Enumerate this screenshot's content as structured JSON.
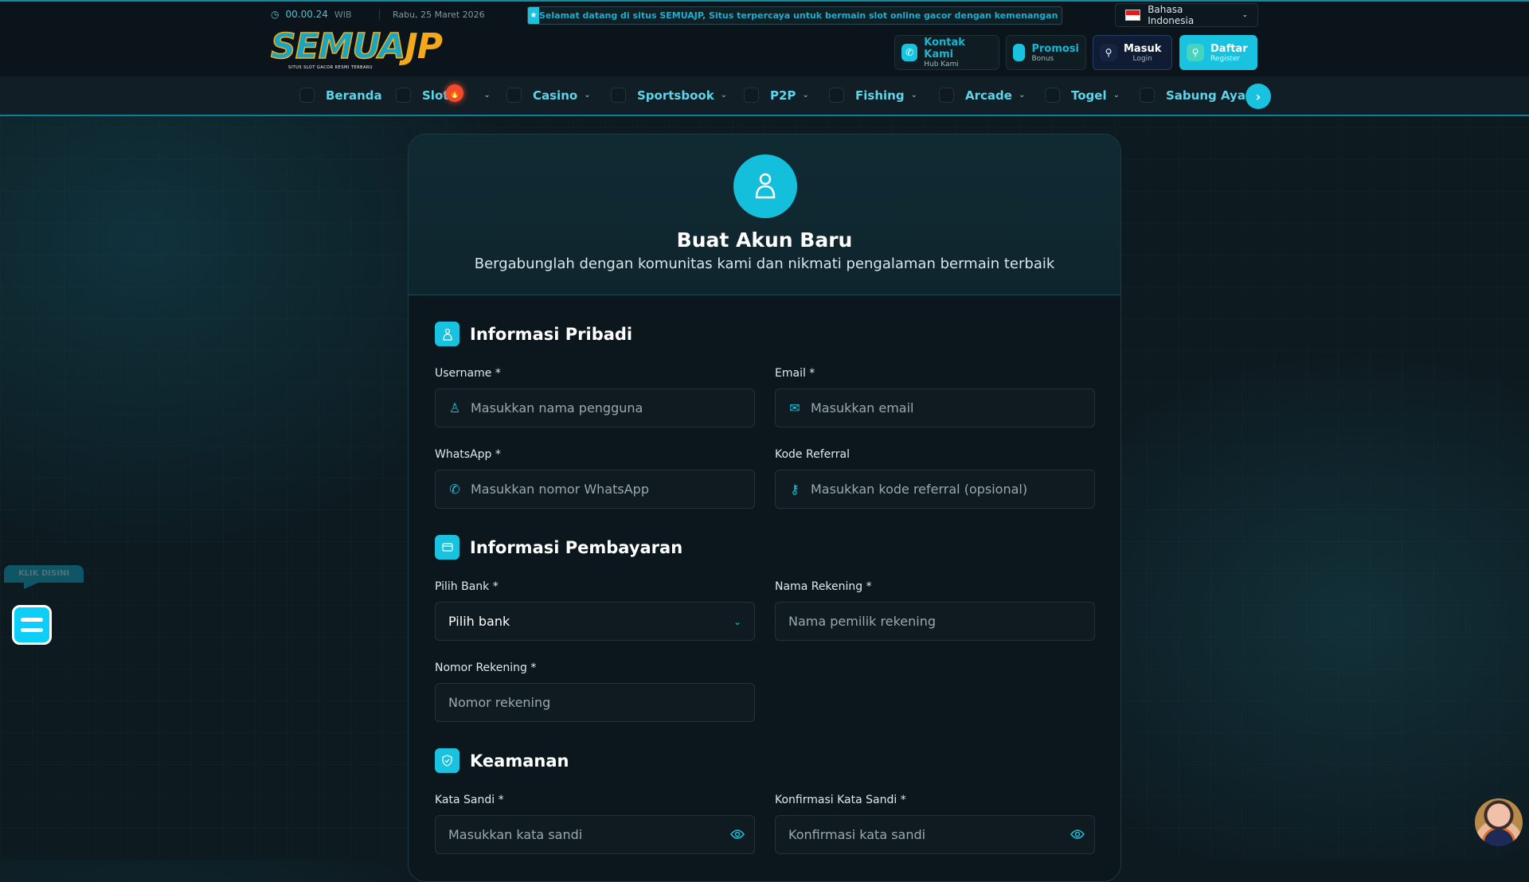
{
  "topbar": {
    "time": "00.00.24",
    "timezone": "WIB",
    "date": "Rabu, 25 Maret 2026",
    "marquee": "Selamat datang di situs SEMUAJP, Situs terpercaya untuk bermain slot online gacor dengan kemenangan maksimal",
    "language": "Bahasa Indonesia"
  },
  "logo": {
    "main": "SEMUA",
    "accent": "JP",
    "tagline": "SITUS SLOT GACOR RESMI TERBARU"
  },
  "header_buttons": {
    "kontak": {
      "label": "Kontak Kami",
      "sub": "Hub Kami"
    },
    "promosi": {
      "label": "Promosi",
      "sub": "Bonus"
    },
    "masuk": {
      "label": "Masuk",
      "sub": "Login"
    },
    "daftar": {
      "label": "Daftar",
      "sub": "Register"
    }
  },
  "nav": [
    "Beranda",
    "Slot",
    "Casino",
    "Sportsbook",
    "P2P",
    "Fishing",
    "Arcade",
    "Togel",
    "Sabung Ayam"
  ],
  "card": {
    "title": "Buat Akun Baru",
    "subtitle": "Bergabunglah dengan komunitas kami dan nikmati pengalaman bermain terbaik"
  },
  "sections": {
    "personal": {
      "title": "Informasi Pribadi",
      "username": {
        "label": "Username *",
        "placeholder": "Masukkan nama pengguna"
      },
      "email": {
        "label": "Email *",
        "placeholder": "Masukkan email"
      },
      "whatsapp": {
        "label": "WhatsApp *",
        "placeholder": "Masukkan nomor WhatsApp"
      },
      "referral": {
        "label": "Kode Referral",
        "placeholder": "Masukkan kode referral (opsional)"
      }
    },
    "payment": {
      "title": "Informasi Pembayaran",
      "bank": {
        "label": "Pilih Bank *",
        "value": "Pilih bank"
      },
      "account_name": {
        "label": "Nama Rekening *",
        "placeholder": "Nama pemilik rekening"
      },
      "account_number": {
        "label": "Nomor Rekening *",
        "placeholder": "Nomor rekening"
      }
    },
    "security": {
      "title": "Keamanan",
      "password": {
        "label": "Kata Sandi *",
        "placeholder": "Masukkan kata sandi"
      },
      "confirm": {
        "label": "Konfirmasi Kata Sandi *",
        "placeholder": "Konfirmasi kata sandi"
      }
    }
  },
  "widget": {
    "klik": "KLIK DISINI"
  },
  "colors": {
    "accent": "#19c3e0",
    "background": "#0d1a20",
    "hot": "#f24a2a"
  }
}
